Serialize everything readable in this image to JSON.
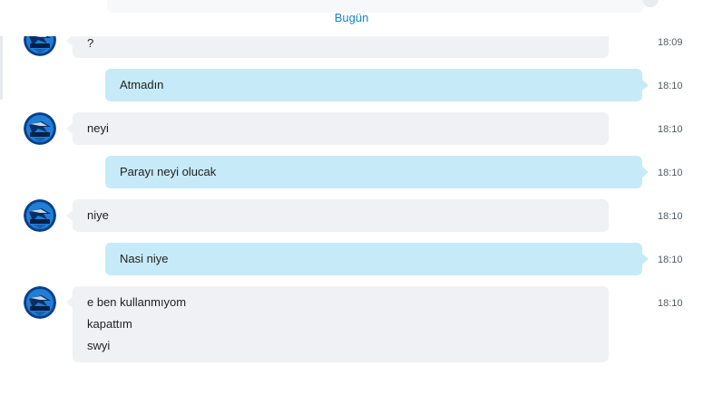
{
  "date_separator": "Bugün",
  "colors": {
    "accent": "#1a84c7",
    "incoming_bubble": "#eff1f5",
    "outgoing_bubble": "#c7eaf8"
  },
  "messages": [
    {
      "direction": "incoming",
      "avatar": "blue-bird-avatar",
      "lines": [
        "?"
      ],
      "time": "18:09"
    },
    {
      "direction": "outgoing",
      "lines": [
        "Atmadın"
      ],
      "time": "18:10"
    },
    {
      "direction": "incoming",
      "avatar": "blue-bird-avatar",
      "lines": [
        "neyi"
      ],
      "time": "18:10"
    },
    {
      "direction": "outgoing",
      "lines": [
        "Parayı neyi olucak"
      ],
      "time": "18:10"
    },
    {
      "direction": "incoming",
      "avatar": "blue-bird-avatar",
      "lines": [
        "niye"
      ],
      "time": "18:10"
    },
    {
      "direction": "outgoing",
      "lines": [
        "Nasi niye"
      ],
      "time": "18:10"
    },
    {
      "direction": "incoming",
      "avatar": "blue-bird-avatar",
      "lines": [
        "e ben kullanmıyom",
        "kapattım",
        "swyi"
      ],
      "time": "18:10"
    }
  ]
}
